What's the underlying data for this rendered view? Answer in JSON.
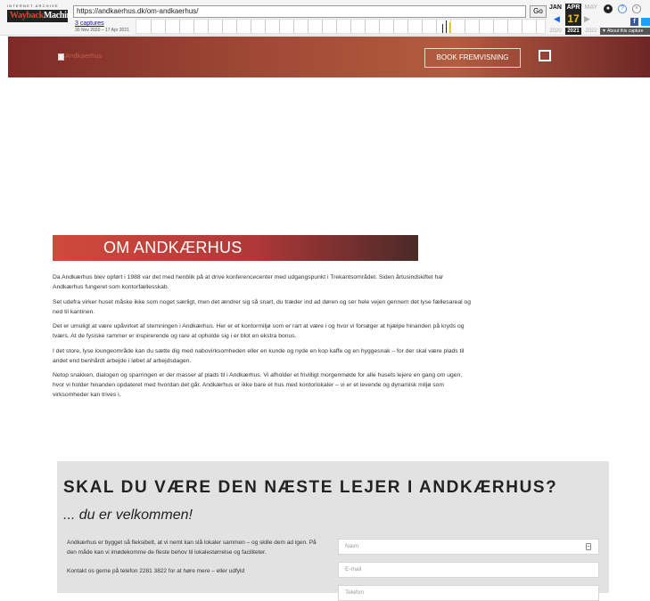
{
  "wayback": {
    "logo_top": "INTERNET ARCHIVE",
    "logo_wayback": "Wayback",
    "logo_machine": "Machine",
    "url": "https://andkaerhus.dk/om-andkaerhus/",
    "go_label": "Go",
    "captures_label": "3 captures",
    "date_range": "30 Nov 2020 – 17 Apr 2021",
    "months": {
      "prev": "JAN",
      "current": "APR",
      "next": "MAY"
    },
    "day": "17",
    "years": {
      "prev": "2020",
      "current": "2021",
      "next": "2022"
    },
    "about_label": "▼ About this capture"
  },
  "header": {
    "logo_alt": "Andkaerhus",
    "book_button": "BOOK FREMVISNING"
  },
  "about": {
    "title": "OM ANDKÆRHUS",
    "paragraphs": [
      "Da Andkærhus blev opført i 1988 var det med henblik på at drive konferencecenter med udgangspunkt i Trekantsområdet. Siden årtusindskiftet har Andkærhus fungeret som kontorfællesskab.",
      "Set udefra virker huset måske ikke som noget særligt, men det ændrer sig så snart, du træder ind ad døren og ser hele vejen gennem det lyse fællesareal og ned til kantinen.",
      "Det er umuligt at være upåvirket af stemningen i Andkærhus. Her er et kontormiljø som er rart at være i og hvor vi forsøger at hjælpe hinanden på kryds og tværs. At de fysiske rammer er inspirerende og rare at opholde sig i er blot en ekstra bonus.",
      "I det store, lyse loungeområde kan du sætte dig med nabovirksomheden eller en kunde og nyde en kop kaffe og en hyggesnak – for der skal være plads til andet end benhårdt arbejde i løbet af arbejdsdagen.",
      "Netop snakken, dialogen og sparringen er der masser af plads til i Andkærhus. Vi afholder et frivilligt morgenmøde for alle husets lejere en gang om ugen, hvor vi holder hinanden opdateret med hvordan det går. Andkærhus er ikke bare et hus med kontorlokaler – vi er et levende og dynamisk miljø som virksomheder kan trives i."
    ]
  },
  "cta": {
    "heading": "SKAL DU VÆRE DEN NÆSTE LEJER I ANDKÆRHUS?",
    "subheading": "... du er velkommen!",
    "text1": "Andkærhus er bygget så fleksibelt, at vi nemt kan slå lokaler sammen – og skille dem ad igen. På den måde kan vi imødekomme de fleste behov til lokalestørrelse og faciliteter.",
    "text2": "Kontakt os gerne på telefon 2281 3822 for at høre mere – eller udfyld",
    "form": {
      "name_placeholder": "Navn",
      "email_placeholder": "E-mail",
      "phone_placeholder": "Telefon"
    }
  }
}
